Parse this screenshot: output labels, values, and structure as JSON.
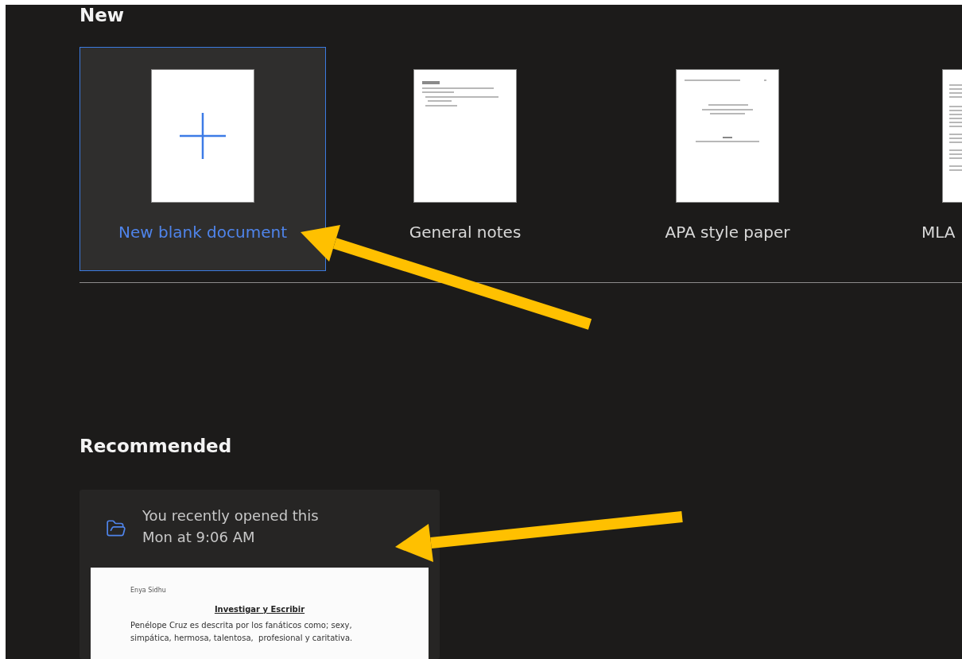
{
  "new_section": {
    "heading": "New",
    "templates": [
      {
        "label": "New blank document",
        "kind": "blank",
        "selected": true
      },
      {
        "label": "General notes",
        "kind": "notes",
        "selected": false
      },
      {
        "label": "APA style paper",
        "kind": "apa",
        "selected": false
      },
      {
        "label": "MLA",
        "kind": "mla",
        "selected": false
      }
    ]
  },
  "recommended_section": {
    "heading": "Recommended",
    "cards": [
      {
        "reason": "You recently opened this",
        "time": "Mon at 9:06 AM",
        "preview": {
          "author": "Enya Sidhu",
          "title": "Investigar y Escribir",
          "paragraph": "Penélope Cruz es descrita por los fanáticos como; sexy, simpática, hermosa, talentosa,  profesional y caritativa."
        }
      }
    ]
  }
}
